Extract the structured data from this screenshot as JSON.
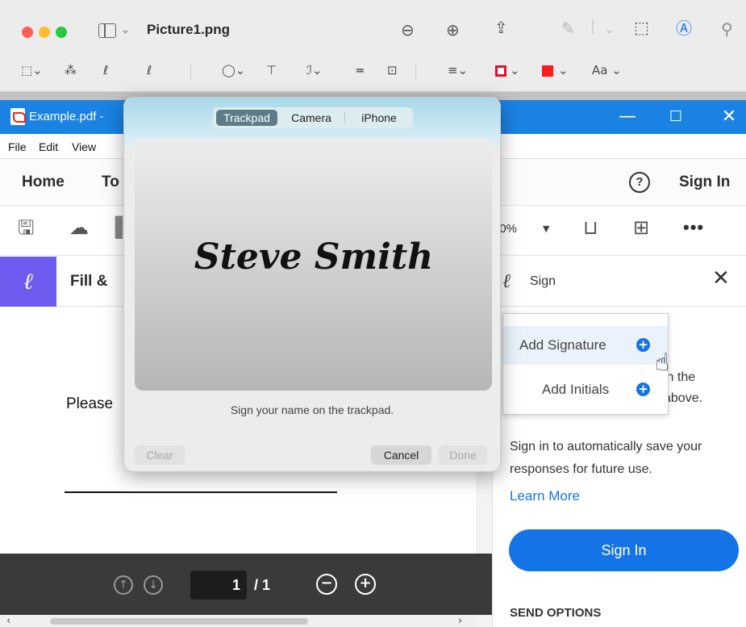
{
  "preview": {
    "title": "Picture1.png",
    "toolbar_text_style": "Aa"
  },
  "acrobat": {
    "window_title": "Example.pdf -",
    "menu": [
      "File",
      "Edit",
      "View"
    ],
    "tabs": [
      "Home",
      "To"
    ],
    "sign_in_tab": "Sign In",
    "help_glyph": "?",
    "zoom_value": "00%",
    "fill_title": "Fill &",
    "document_text": "Please",
    "page_current": "1",
    "page_total": "/ 1"
  },
  "sign_panel": {
    "title": "Sign",
    "menu_items": [
      "Add Signature",
      "Add Initials"
    ],
    "fragment_1": "in the",
    "fragment_2": "above.",
    "info_text": "Sign in to automatically save your responses for future use.",
    "learn_more": "Learn More",
    "sign_in_button": "Sign In",
    "send_options": "SEND OPTIONS"
  },
  "signature_popover": {
    "tabs": [
      "Trackpad",
      "Camera",
      "iPhone"
    ],
    "active_tab": "Trackpad",
    "signature": "Steve Smith",
    "hint": "Sign your name on the trackpad.",
    "clear": "Clear",
    "cancel": "Cancel",
    "done": "Done"
  },
  "colors": {
    "acrobat_blue": "#1a82e2",
    "fill_sign_purple": "#6e5bf0",
    "button_blue": "#1473e6",
    "border_color_swatch": "#e0102e",
    "fill_color_swatch": "#ff1a1a"
  }
}
